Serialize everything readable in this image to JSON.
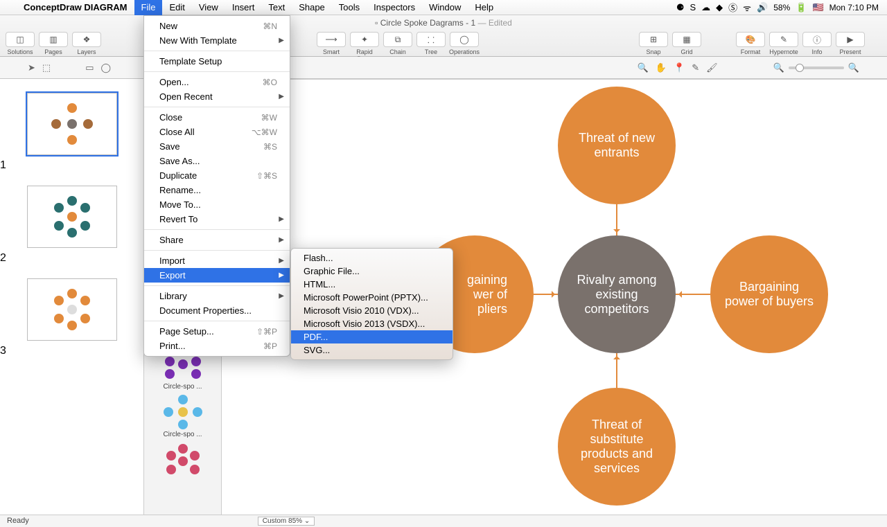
{
  "menubar": {
    "app_title": "ConceptDraw DIAGRAM",
    "items": [
      "File",
      "Edit",
      "View",
      "Insert",
      "Text",
      "Shape",
      "Tools",
      "Inspectors",
      "Window",
      "Help"
    ],
    "open_index": 0,
    "battery": "58%",
    "clock": "Mon 7:10 PM"
  },
  "window": {
    "title": "Circle  Spoke Dagrams - 1",
    "edited": "— Edited"
  },
  "toolbar": {
    "left": [
      "Solutions",
      "Pages",
      "Layers"
    ],
    "mid": [
      "Smart",
      "Rapid Draw",
      "Chain",
      "Tree",
      "Operations"
    ],
    "right1": [
      "Snap",
      "Grid"
    ],
    "right2": [
      "Format",
      "Hypernote",
      "Info",
      "Present"
    ]
  },
  "thumbs": [
    "1",
    "2",
    "3"
  ],
  "library": {
    "items": [
      "Circle-spo ...",
      "Circle-spo ...",
      "Circle-spo ..."
    ]
  },
  "diagram": {
    "center": "Rivalry among existing competitors",
    "top": "Threat of new entrants",
    "right": "Bargaining power of buyers",
    "bottom": "Threat of substitute products and services",
    "left_partial": "gaining\nwer of\npliers"
  },
  "file_menu": [
    {
      "t": "New",
      "sc": "⌘N"
    },
    {
      "t": "New With Template",
      "arr": true
    },
    {
      "sep": true
    },
    {
      "t": "Template Setup"
    },
    {
      "sep": true
    },
    {
      "t": "Open...",
      "sc": "⌘O"
    },
    {
      "t": "Open Recent",
      "arr": true
    },
    {
      "sep": true
    },
    {
      "t": "Close",
      "sc": "⌘W"
    },
    {
      "t": "Close All",
      "sc": "⌥⌘W"
    },
    {
      "t": "Save",
      "sc": "⌘S"
    },
    {
      "t": "Save As..."
    },
    {
      "t": "Duplicate",
      "sc": "⇧⌘S"
    },
    {
      "t": "Rename..."
    },
    {
      "t": "Move To..."
    },
    {
      "t": "Revert To",
      "arr": true
    },
    {
      "sep": true
    },
    {
      "t": "Share",
      "arr": true
    },
    {
      "sep": true
    },
    {
      "t": "Import",
      "arr": true
    },
    {
      "t": "Export",
      "arr": true,
      "hi": true
    },
    {
      "sep": true
    },
    {
      "t": "Library",
      "arr": true
    },
    {
      "t": "Document Properties..."
    },
    {
      "sep": true
    },
    {
      "t": "Page Setup...",
      "sc": "⇧⌘P"
    },
    {
      "t": "Print...",
      "sc": "⌘P"
    }
  ],
  "export_menu": [
    {
      "t": "Flash..."
    },
    {
      "t": "Graphic File..."
    },
    {
      "t": "HTML..."
    },
    {
      "t": "Microsoft PowerPoint (PPTX)..."
    },
    {
      "t": "Microsoft Visio 2010 (VDX)..."
    },
    {
      "t": "Microsoft Visio 2013 (VSDX)..."
    },
    {
      "t": "PDF...",
      "hi": true
    },
    {
      "t": "SVG..."
    }
  ],
  "status": {
    "ready": "Ready",
    "zoom": "Custom 85%"
  }
}
